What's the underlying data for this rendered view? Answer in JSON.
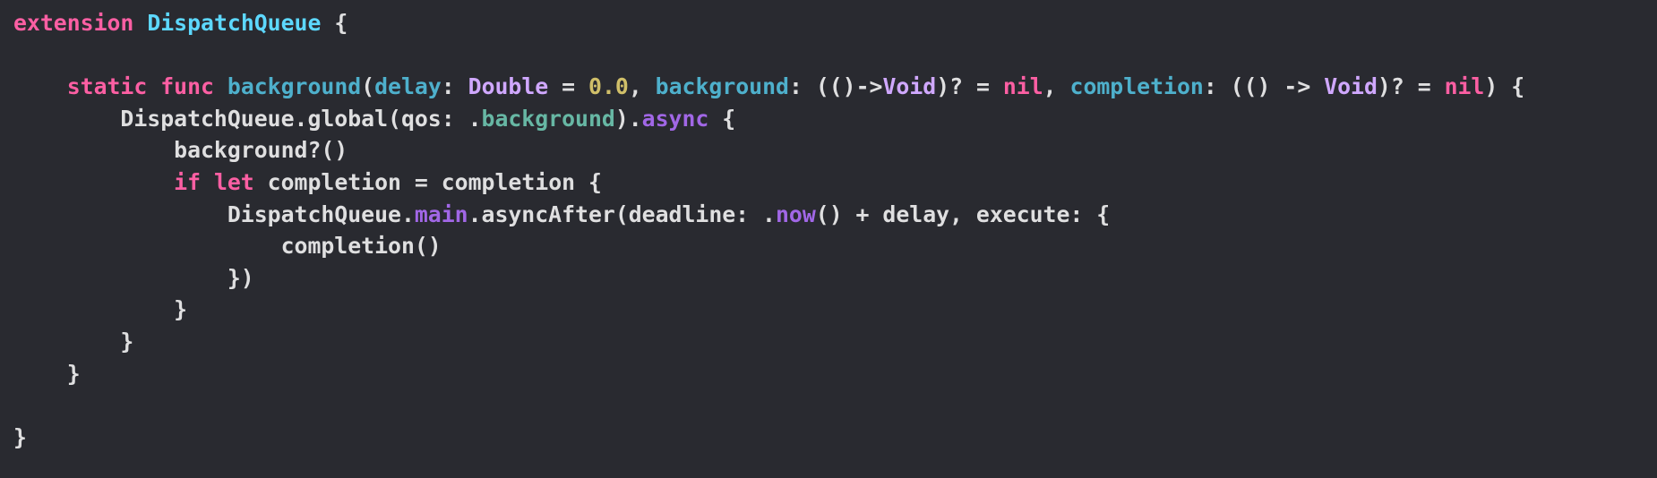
{
  "colors": {
    "background": "#292a30",
    "plain": "#dfdfe0",
    "keyword": "#fc5fa3",
    "type_declaration": "#5dd8ff",
    "declaration_identifier": "#4eb0cc",
    "builtin_type": "#d0a8ff",
    "number": "#d0bf69",
    "member": "#67b7a4",
    "method": "#a167e6"
  },
  "lines": [
    {
      "tokens": [
        {
          "text": "extension",
          "kind": "kw"
        },
        {
          "text": " ",
          "kind": "plain"
        },
        {
          "text": "DispatchQueue",
          "kind": "type"
        },
        {
          "text": " {",
          "kind": "plain"
        }
      ]
    },
    {
      "tokens": []
    },
    {
      "tokens": [
        {
          "text": "    ",
          "kind": "plain"
        },
        {
          "text": "static",
          "kind": "kw"
        },
        {
          "text": " ",
          "kind": "plain"
        },
        {
          "text": "func",
          "kind": "kw"
        },
        {
          "text": " ",
          "kind": "plain"
        },
        {
          "text": "background",
          "kind": "ident"
        },
        {
          "text": "(",
          "kind": "plain"
        },
        {
          "text": "delay",
          "kind": "ident"
        },
        {
          "text": ": ",
          "kind": "plain"
        },
        {
          "text": "Double",
          "kind": "btype"
        },
        {
          "text": " = ",
          "kind": "plain"
        },
        {
          "text": "0.0",
          "kind": "num"
        },
        {
          "text": ", ",
          "kind": "plain"
        },
        {
          "text": "background",
          "kind": "ident"
        },
        {
          "text": ": (()->",
          "kind": "plain"
        },
        {
          "text": "Void",
          "kind": "btype"
        },
        {
          "text": ")? = ",
          "kind": "plain"
        },
        {
          "text": "nil",
          "kind": "kw"
        },
        {
          "text": ", ",
          "kind": "plain"
        },
        {
          "text": "completion",
          "kind": "ident"
        },
        {
          "text": ": (() -> ",
          "kind": "plain"
        },
        {
          "text": "Void",
          "kind": "btype"
        },
        {
          "text": ")? = ",
          "kind": "plain"
        },
        {
          "text": "nil",
          "kind": "kw"
        },
        {
          "text": ") {",
          "kind": "plain"
        }
      ]
    },
    {
      "tokens": [
        {
          "text": "        DispatchQueue.global(qos: .",
          "kind": "plain"
        },
        {
          "text": "background",
          "kind": "mem"
        },
        {
          "text": ").",
          "kind": "plain"
        },
        {
          "text": "async",
          "kind": "meth"
        },
        {
          "text": " {",
          "kind": "plain"
        }
      ]
    },
    {
      "tokens": [
        {
          "text": "            background?()",
          "kind": "plain"
        }
      ]
    },
    {
      "tokens": [
        {
          "text": "            ",
          "kind": "plain"
        },
        {
          "text": "if",
          "kind": "kw"
        },
        {
          "text": " ",
          "kind": "plain"
        },
        {
          "text": "let",
          "kind": "kw"
        },
        {
          "text": " completion = completion {",
          "kind": "plain"
        }
      ]
    },
    {
      "tokens": [
        {
          "text": "                DispatchQueue.",
          "kind": "plain"
        },
        {
          "text": "main",
          "kind": "meth"
        },
        {
          "text": ".asyncAfter(deadline: .",
          "kind": "plain"
        },
        {
          "text": "now",
          "kind": "meth"
        },
        {
          "text": "() + delay, execute: {",
          "kind": "plain"
        }
      ]
    },
    {
      "tokens": [
        {
          "text": "                    completion()",
          "kind": "plain"
        }
      ]
    },
    {
      "tokens": [
        {
          "text": "                })",
          "kind": "plain"
        }
      ]
    },
    {
      "tokens": [
        {
          "text": "            }",
          "kind": "plain"
        }
      ]
    },
    {
      "tokens": [
        {
          "text": "        }",
          "kind": "plain"
        }
      ]
    },
    {
      "tokens": [
        {
          "text": "    }",
          "kind": "plain"
        }
      ]
    },
    {
      "tokens": []
    },
    {
      "tokens": [
        {
          "text": "}",
          "kind": "plain"
        }
      ]
    }
  ]
}
